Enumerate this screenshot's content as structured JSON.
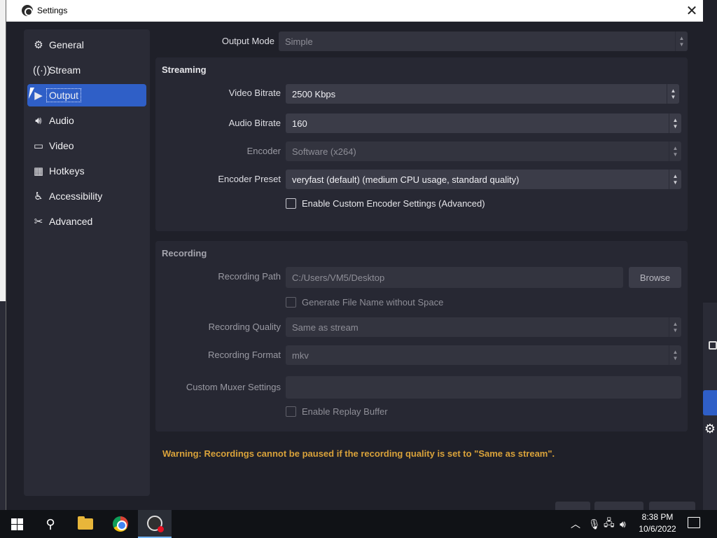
{
  "window": {
    "title": "Settings"
  },
  "sidebar": {
    "items": [
      {
        "label": "General",
        "icon": "gear-icon"
      },
      {
        "label": "Stream",
        "icon": "antenna-icon"
      },
      {
        "label": "Output",
        "icon": "camera-icon",
        "active": true
      },
      {
        "label": "Audio",
        "icon": "speaker-icon"
      },
      {
        "label": "Video",
        "icon": "monitor-icon"
      },
      {
        "label": "Hotkeys",
        "icon": "keyboard-icon"
      },
      {
        "label": "Accessibility",
        "icon": "accessibility-icon"
      },
      {
        "label": "Advanced",
        "icon": "tools-icon"
      }
    ]
  },
  "output": {
    "output_mode_label": "Output Mode",
    "output_mode_value": "Simple",
    "streaming": {
      "title": "Streaming",
      "video_bitrate_label": "Video Bitrate",
      "video_bitrate_value": "2500 Kbps",
      "audio_bitrate_label": "Audio Bitrate",
      "audio_bitrate_value": "160",
      "encoder_label": "Encoder",
      "encoder_value": "Software (x264)",
      "encoder_preset_label": "Encoder Preset",
      "encoder_preset_value": "veryfast (default) (medium CPU usage, standard quality)",
      "custom_encoder_label": "Enable Custom Encoder Settings (Advanced)",
      "custom_encoder_checked": false
    },
    "recording": {
      "title": "Recording",
      "path_label": "Recording Path",
      "path_value": "C:/Users/VM5/Desktop",
      "browse_label": "Browse",
      "filename_nospace_label": "Generate File Name without Space",
      "filename_nospace_checked": false,
      "quality_label": "Recording Quality",
      "quality_value": "Same as stream",
      "format_label": "Recording Format",
      "format_value": "mkv",
      "muxer_label": "Custom Muxer Settings",
      "muxer_value": "",
      "replay_buffer_label": "Enable Replay Buffer",
      "replay_buffer_checked": false
    },
    "warning": "Warning: Recordings cannot be paused if the recording quality is set to \"Same as stream\"."
  },
  "taskbar": {
    "time": "8:38 PM",
    "date": "10/6/2022"
  },
  "colors": {
    "accent": "#2f5fc7",
    "warning": "#d9a23a",
    "background": "#1f2029",
    "panel": "#2a2b36"
  }
}
